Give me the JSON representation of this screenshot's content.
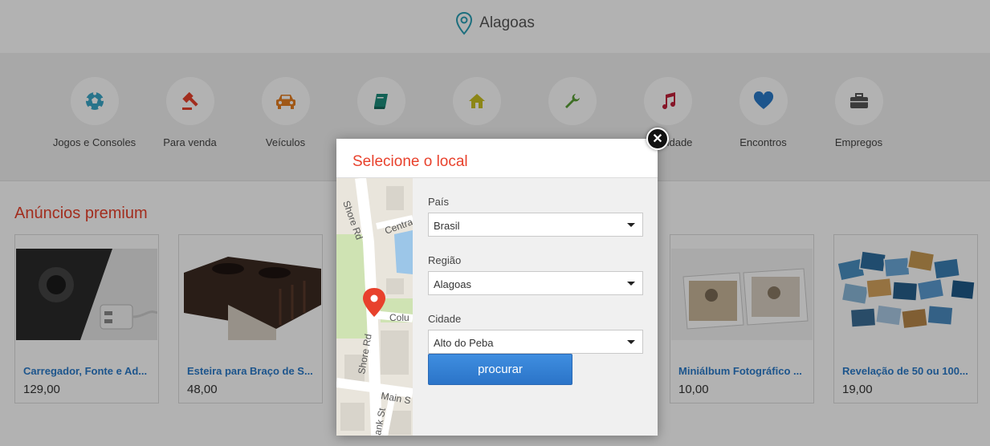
{
  "header": {
    "location": "Alagoas"
  },
  "categories": [
    {
      "label": "Jogos e Consoles",
      "icon": "soccer-ball-icon",
      "color": "#3aa6c7"
    },
    {
      "label": "Para venda",
      "icon": "gavel-icon",
      "color": "#e8412c"
    },
    {
      "label": "Veículos",
      "icon": "car-icon",
      "color": "#e67e22"
    },
    {
      "label": "",
      "icon": "book-icon",
      "color": "#1a8c7a"
    },
    {
      "label": "",
      "icon": "house-icon",
      "color": "#c9c021"
    },
    {
      "label": "",
      "icon": "wrench-icon",
      "color": "#5aa036"
    },
    {
      "label": "idade",
      "icon": "music-note-icon",
      "color": "#c0203a"
    },
    {
      "label": "Encontros",
      "icon": "heart-icon",
      "color": "#2a7ac9"
    },
    {
      "label": "Empregos",
      "icon": "briefcase-icon",
      "color": "#555555"
    }
  ],
  "premium": {
    "title": "Anúncios premium",
    "ads": [
      {
        "title": "Carregador, Fonte e Ad...",
        "price": "129,00"
      },
      {
        "title": "Esteira para Braço de S...",
        "price": "48,00"
      },
      {
        "title": "Miniálbum Fotográfico ...",
        "price": "10,00"
      },
      {
        "title": "Revelação de 50 ou 100...",
        "price": "19,00"
      }
    ]
  },
  "modal": {
    "title": "Selecione o local",
    "close_icon": "close-icon",
    "map_labels": {
      "street1": "Shore Rd",
      "street2": "Centra",
      "street3": "Colu",
      "street4": "Shore Rd",
      "street5": "Main S",
      "street6": "ank St"
    },
    "fields": [
      {
        "label": "País",
        "value": "Brasil"
      },
      {
        "label": "Região",
        "value": "Alagoas"
      },
      {
        "label": "Cidade",
        "value": "Alto do Peba"
      }
    ],
    "search_label": "procurar"
  },
  "colors": {
    "accent": "#e8412c",
    "link": "#2a7ac9",
    "button": "#2b74c8"
  }
}
